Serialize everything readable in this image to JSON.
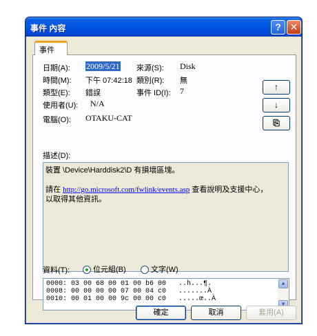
{
  "window": {
    "title": "事件 內容"
  },
  "titlebar": {
    "help_icon": "?",
    "close_icon": "✕"
  },
  "tab": {
    "label": "事件"
  },
  "info": {
    "date_label": "日期(A):",
    "date_value": "2009/5/21",
    "time_label": "時間(M):",
    "time_value": "下午 07:42:18",
    "type_label": "類型(E):",
    "type_value": "錯誤",
    "user_label": "使用者(U):",
    "user_value": "N/A",
    "computer_label": "電腦(O):",
    "computer_value": "OTAKU-CAT",
    "source_label": "來源(S):",
    "source_value": "Disk",
    "category_label": "類別(R):",
    "category_value": "無",
    "eventid_label": "事件 ID(I):",
    "eventid_value": "7"
  },
  "side_buttons": {
    "up": "↑",
    "down": "↓",
    "copy": "⎘"
  },
  "description": {
    "label": "描述(D):",
    "line1": "裝置 \\Device\\Harddisk2\\D 有損壞區塊。",
    "line2_pre": "請在 ",
    "link": "http://go.microsoft.com/fwlink/events.asp",
    "line2_post": " 查看說明及支援中心，",
    "line3": "以取得其他資訊。"
  },
  "data_section": {
    "label": "資料(T):",
    "radio_bytes": "位元組(B)",
    "radio_words": "文字(W)",
    "hex_lines": [
      "0000: 03 00 68 00 01 00 b6 00   ..h...¶.",
      "0008: 00 00 00 00 07 00 04 c0   .......À",
      "0010: 00 01 00 00 9c 00 00 c0   .....œ..À"
    ]
  },
  "buttons": {
    "ok": "確定",
    "cancel": "取消",
    "apply": "套用(A)"
  }
}
